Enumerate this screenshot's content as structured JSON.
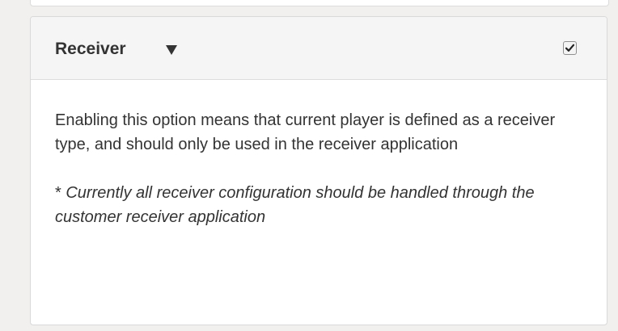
{
  "panel": {
    "title": "Receiver",
    "caret_icon": "caret-down-icon",
    "checkbox_checked": true,
    "description": "Enabling this option means that current player is defined as a receiver type, and should only be used in the receiver application",
    "note_prefix": "* ",
    "note_text": "Currently all receiver configuration should be handled through the customer receiver application"
  }
}
